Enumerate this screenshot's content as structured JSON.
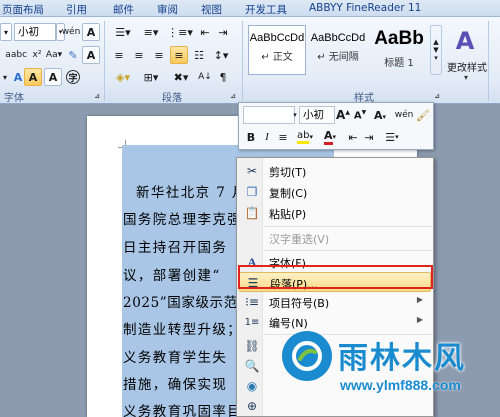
{
  "ribbon": {
    "tabs": [
      "页面布局",
      "引用",
      "邮件",
      "审阅",
      "视图",
      "开发工具",
      "ABBYY FineReader 11"
    ],
    "font": {
      "size": "小初",
      "group_label": "字体"
    },
    "paragraph": {
      "group_label": "段落"
    },
    "styles": {
      "group_label": "样式",
      "items": [
        {
          "sample": "AaBbCcDd",
          "name": "↵ 正文"
        },
        {
          "sample": "AaBbCcDd",
          "name": "↵ 无间隔"
        },
        {
          "sample": "AaBb",
          "name": "标题 1"
        }
      ],
      "change_styles_label": "更改样式"
    }
  },
  "document": {
    "lines": [
      "新华社北京 7 月",
      "国务院总理李克强",
      "日主持召开国务",
      "议，部署创建“",
      "2025”国家级示范",
      "制造业转型升级；",
      "义务教育学生失",
      "措施，确保实现",
      "义务教育巩固率目"
    ]
  },
  "mini_toolbar": {
    "font_size": "小初"
  },
  "context_menu": {
    "items": [
      {
        "icon": "cut-icon",
        "label": "剪切(T)",
        "enabled": true
      },
      {
        "icon": "copy-icon",
        "label": "复制(C)",
        "enabled": true
      },
      {
        "icon": "paste-icon",
        "label": "粘贴(P)",
        "enabled": true
      },
      {
        "icon": "",
        "label": "汉字重选(V)",
        "enabled": false
      },
      {
        "icon": "font-icon",
        "label": "字体(F)...",
        "enabled": true
      },
      {
        "icon": "paragraph-icon",
        "label": "段落(P)...",
        "enabled": true,
        "highlighted": true
      },
      {
        "icon": "bullets-icon",
        "label": "项目符号(B)",
        "enabled": true,
        "submenu": true
      },
      {
        "icon": "numbering-icon",
        "label": "编号(N)",
        "enabled": true,
        "submenu": true
      }
    ]
  },
  "watermark": {
    "title": "雨林木风",
    "url": "www.ylmf888.com"
  }
}
